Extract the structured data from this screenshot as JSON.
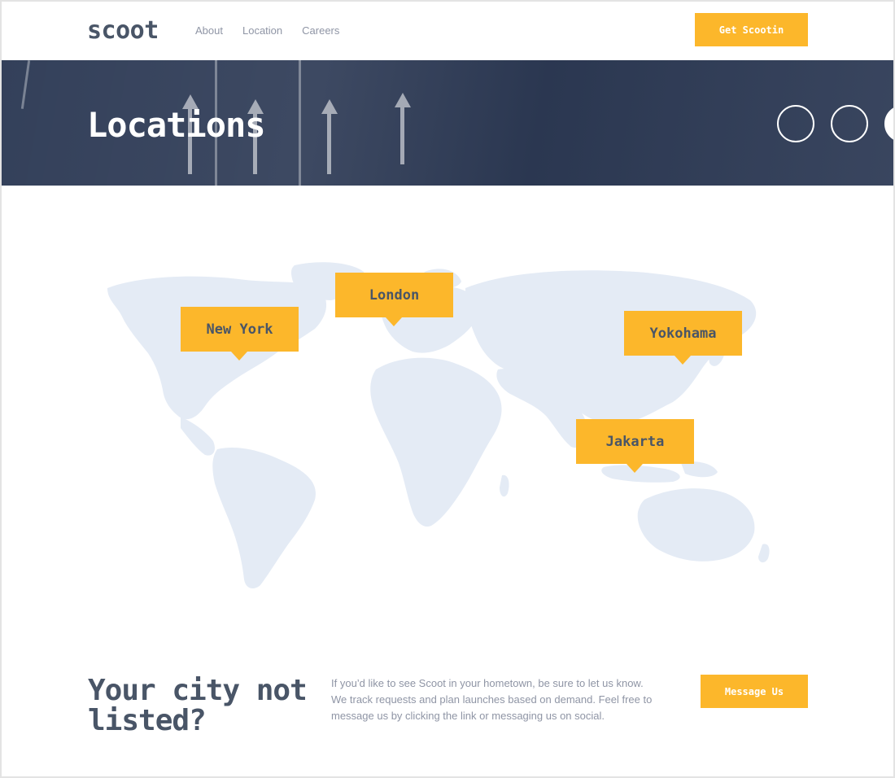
{
  "header": {
    "logo": "scoot",
    "nav": [
      "About",
      "Location",
      "Careers"
    ],
    "cta_label": "Get Scootin"
  },
  "hero": {
    "title": "Locations",
    "carousel_dots": 3
  },
  "map": {
    "pins": [
      "New York",
      "London",
      "Yokohama",
      "Jakarta"
    ]
  },
  "cta": {
    "title": "Your city not listed?",
    "text": "If you’d like to see Scoot in your hometown, be sure to let us know. We track requests and plan launches based on demand. Feel free to message us by clicking the link or messaging us on social.",
    "button_label": "Message Us"
  },
  "colors": {
    "accent": "#fcb72b",
    "hero_bg": "#2d3a55",
    "map_land": "#e4ebf5",
    "text_dark": "#495567",
    "text_muted": "#8f95a5"
  }
}
